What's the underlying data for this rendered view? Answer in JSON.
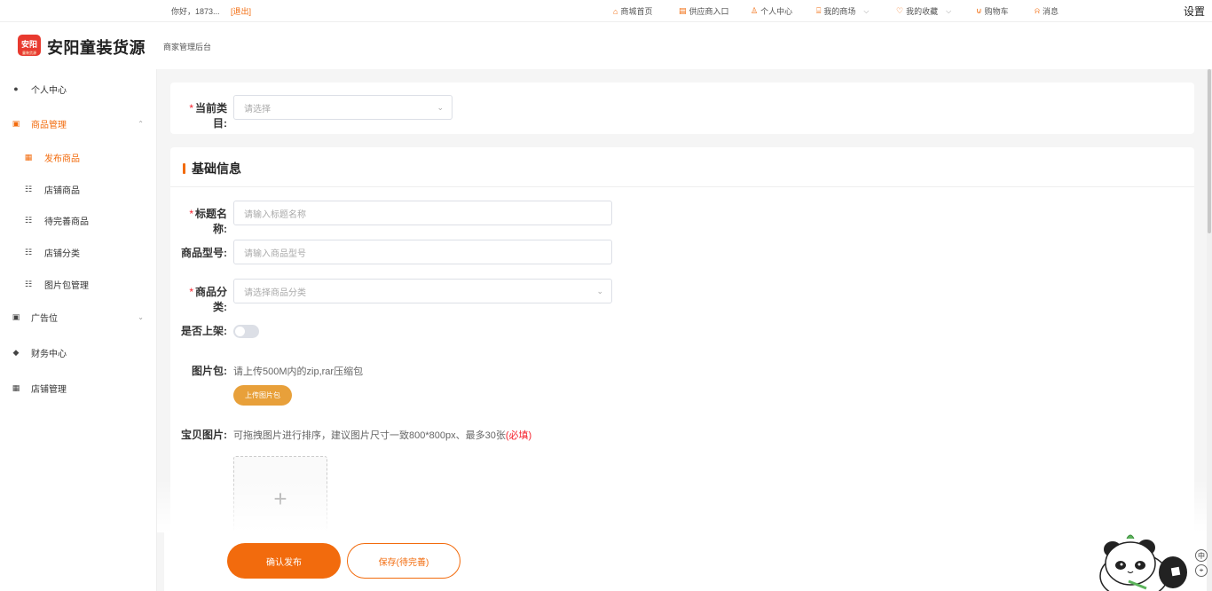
{
  "topbar": {
    "greeting": "你好，1873...",
    "logout": "[退出]",
    "nav": [
      {
        "label": "商城首页",
        "icon": "home-icon",
        "glyph": "⌂"
      },
      {
        "label": "供应商入口",
        "icon": "supplier-icon",
        "glyph": "▤"
      },
      {
        "label": "个人中心",
        "icon": "user-icon",
        "glyph": "♙"
      },
      {
        "label": "我的商场",
        "icon": "store-icon",
        "glyph": "⌸"
      },
      {
        "label": "我的收藏",
        "icon": "heart-icon",
        "glyph": "♡"
      },
      {
        "label": "购物车",
        "icon": "cart-icon",
        "glyph": "⊍"
      },
      {
        "label": "消息",
        "icon": "bell-icon",
        "glyph": "⍾"
      }
    ],
    "settings": "设置"
  },
  "header": {
    "logo_mark": "安阳",
    "logo_mark_sub": "童装货源",
    "brand": "安阳童装货源",
    "subtitle": "商家管理后台"
  },
  "sidebar": {
    "items": [
      {
        "label": "个人中心",
        "icon": "person-icon"
      },
      {
        "label": "商品管理",
        "icon": "briefcase-icon"
      },
      {
        "label": "发布商品",
        "icon": "grid-icon"
      },
      {
        "label": "店铺商品",
        "icon": "sitemap-icon"
      },
      {
        "label": "待完善商品",
        "icon": "sitemap-icon"
      },
      {
        "label": "店铺分类",
        "icon": "sitemap-icon"
      },
      {
        "label": "图片包管理",
        "icon": "sitemap-icon"
      },
      {
        "label": "广告位",
        "icon": "briefcase-icon"
      },
      {
        "label": "财务中心",
        "icon": "diamond-icon"
      },
      {
        "label": "店铺管理",
        "icon": "table-icon"
      }
    ]
  },
  "form": {
    "category": {
      "label": "当前类目:",
      "placeholder": "请选择"
    },
    "section_title": "基础信息",
    "title": {
      "label": "标题名称:",
      "placeholder": "请输入标题名称"
    },
    "model": {
      "label": "商品型号:",
      "placeholder": "请输入商品型号"
    },
    "product_category": {
      "label": "商品分类:",
      "placeholder": "请选择商品分类"
    },
    "on_shelf": {
      "label": "是否上架:",
      "enabled": false
    },
    "image_pack": {
      "label": "图片包:",
      "hint": "请上传500M内的zip,rar压缩包",
      "button": "上传图片包"
    },
    "photos": {
      "label": "宝贝图片:",
      "hint": "可拖拽图片进行排序，建议图片尺寸一致800*800px、最多30张",
      "required": "(必填)"
    }
  },
  "footer": {
    "confirm": "确认发布",
    "save": "保存(待完善)"
  },
  "side_tools": [
    "中",
    "⌖"
  ],
  "colors": {
    "accent": "#f26b0d",
    "upload": "#e8a03a",
    "required": "#f5222d"
  }
}
